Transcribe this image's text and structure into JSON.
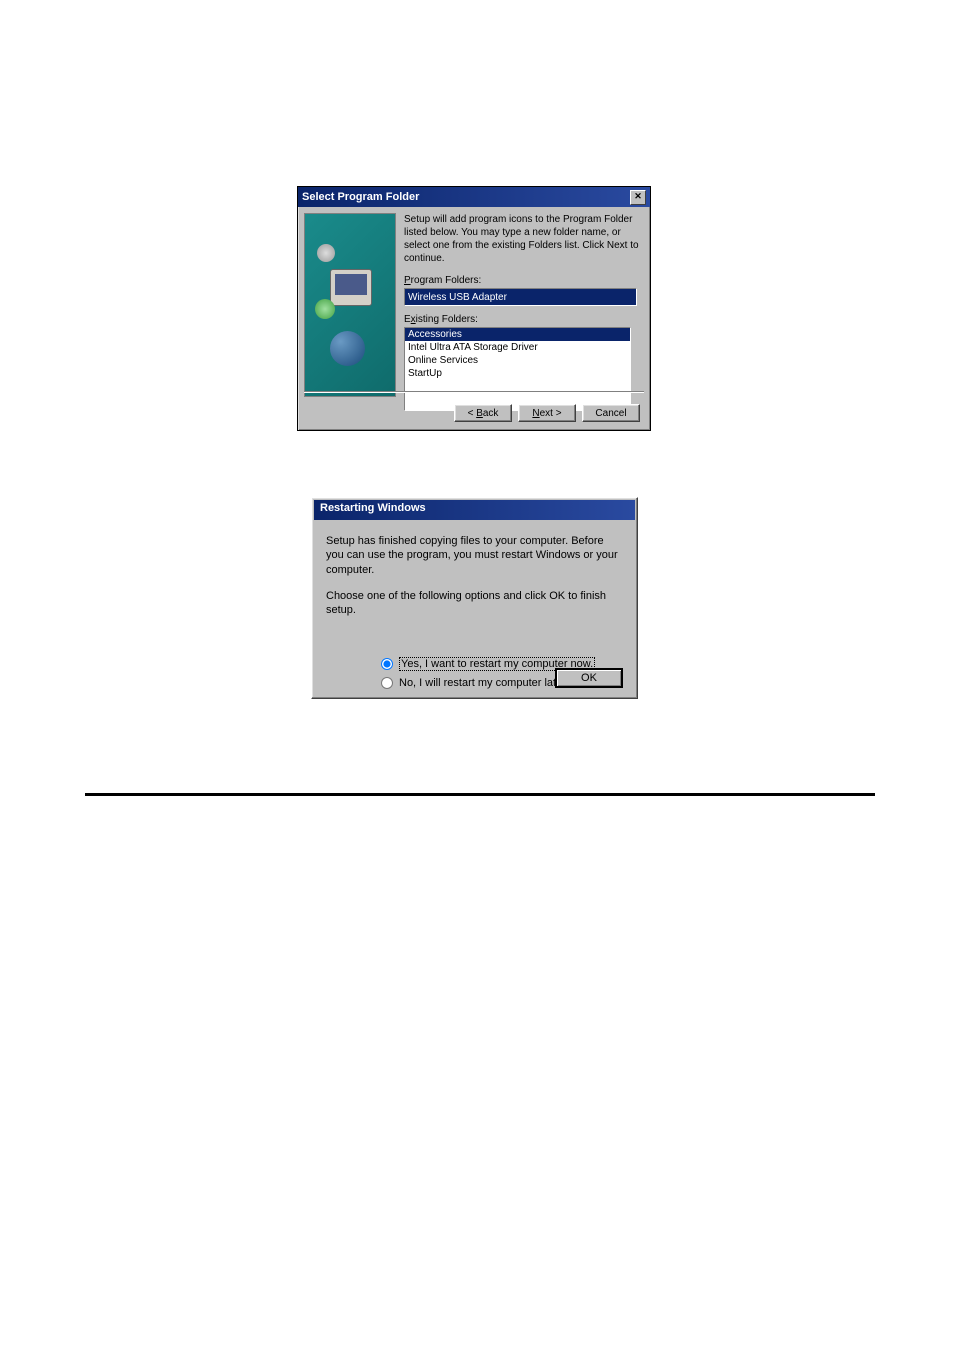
{
  "dialog1": {
    "title": "Select Program Folder",
    "intro": "Setup will add program icons to the Program Folder listed below. You may type a new folder name, or select one from the existing Folders list.  Click Next to continue.",
    "program_folders_label": "Program Folders:",
    "program_folders_value": "Wireless USB Adapter",
    "existing_folders_label": "Existing Folders:",
    "existing_folders": [
      {
        "text": "Accessories",
        "selected": true
      },
      {
        "text": "Intel Ultra ATA Storage Driver",
        "selected": false
      },
      {
        "text": "Online Services",
        "selected": false
      },
      {
        "text": "StartUp",
        "selected": false
      }
    ],
    "buttons": {
      "back": "< Back",
      "next": "Next >",
      "cancel": "Cancel"
    }
  },
  "dialog2": {
    "title": "Restarting Windows",
    "para1": "Setup has finished copying files to your computer.  Before you can use the program, you must restart Windows or your computer.",
    "para2": "Choose one of the following options and click OK to finish setup.",
    "radio_yes": "Yes, I want to restart my computer now.",
    "radio_no": "No, I will restart my computer later.",
    "ok": "OK"
  }
}
